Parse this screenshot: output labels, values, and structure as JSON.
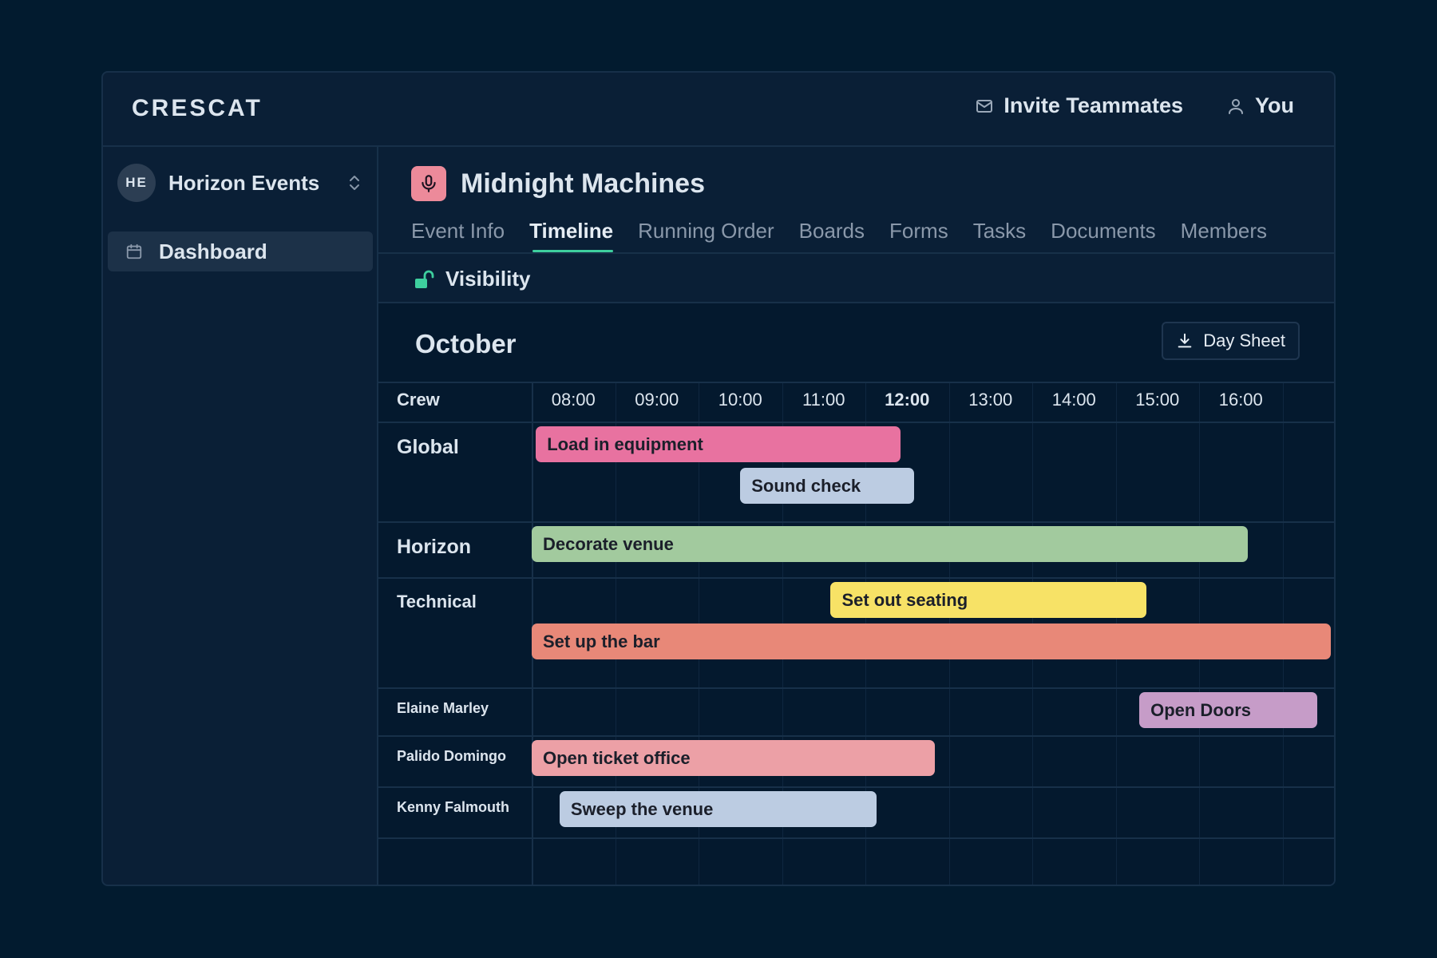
{
  "app": {
    "logo": "CRESCAT"
  },
  "topbar": {
    "invite_label": "Invite Teammates",
    "user_label": "You"
  },
  "sidebar": {
    "org_initials": "HE",
    "org_name": "Horizon Events",
    "nav": [
      {
        "label": "Dashboard",
        "icon": "calendar-icon"
      }
    ]
  },
  "event": {
    "title": "Midnight Machines",
    "icon": "microphone-icon",
    "icon_color": "#ec8a9a"
  },
  "tabs": [
    {
      "label": "Event Info",
      "active": false
    },
    {
      "label": "Timeline",
      "active": true
    },
    {
      "label": "Running Order",
      "active": false
    },
    {
      "label": "Boards",
      "active": false
    },
    {
      "label": "Forms",
      "active": false
    },
    {
      "label": "Tasks",
      "active": false
    },
    {
      "label": "Documents",
      "active": false
    },
    {
      "label": "Members",
      "active": false
    }
  ],
  "visibility": {
    "label": "Visibility",
    "icon": "unlock-icon",
    "icon_color": "#3ecf9e"
  },
  "timeline": {
    "month": "October",
    "day_sheet_label": "Day Sheet",
    "crew_header": "Crew",
    "hours": [
      "08:00",
      "09:00",
      "10:00",
      "11:00",
      "12:00",
      "13:00",
      "14:00",
      "15:00",
      "16:00"
    ],
    "current_hour": "12:00",
    "rows": [
      {
        "label": "Global",
        "tasks": [
          {
            "label": "Load in equipment",
            "start": "08:03",
            "end": "12:25",
            "color": "#e872a0"
          },
          {
            "label": "Sound check",
            "start": "10:30",
            "end": "12:35",
            "color": "#bccce2"
          }
        ]
      },
      {
        "label": "Horizon",
        "tasks": [
          {
            "label": "Decorate venue",
            "start": "08:00",
            "end": "16:35",
            "color": "#a2ca9e"
          }
        ]
      },
      {
        "label": "Technical",
        "tasks": [
          {
            "label": "Set out seating",
            "start": "11:35",
            "end": "15:22",
            "color": "#f7e266"
          },
          {
            "label": "Set up the bar",
            "start": "08:00",
            "end": "17:35",
            "color": "#e88878"
          }
        ]
      },
      {
        "label": "Elaine Marley",
        "tasks": [
          {
            "label": "Open Doors",
            "start": "15:17",
            "end": "17:25",
            "color": "#c69cc8"
          }
        ]
      },
      {
        "label": "Palido Domingo",
        "tasks": [
          {
            "label": "Open ticket office",
            "start": "08:00",
            "end": "12:50",
            "color": "#eca0a6"
          }
        ]
      },
      {
        "label": "Kenny Falmouth",
        "tasks": [
          {
            "label": "Sweep the venue",
            "start": "08:20",
            "end": "12:08",
            "color": "#bccce2"
          }
        ]
      }
    ]
  }
}
